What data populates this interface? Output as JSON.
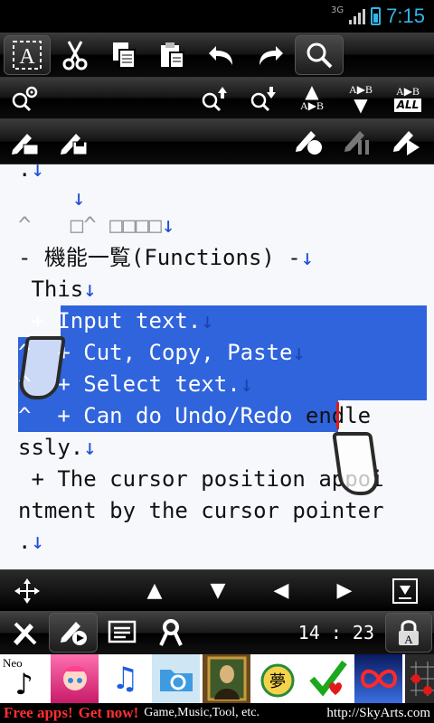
{
  "status": {
    "network": "3G",
    "time": "7:15"
  },
  "toolbar_main": {
    "icons": [
      "select-text-icon",
      "cut-icon",
      "copy-icon",
      "paste-icon",
      "undo-icon",
      "redo-icon",
      "search-icon"
    ]
  },
  "toolbar_search": {
    "icons": [
      "search-settings-icon",
      "search-previous-icon",
      "search-next-icon",
      "replace-icon",
      "replace-next-icon",
      "replace-all-icon"
    ],
    "replace_label": "A▶B",
    "replace_all_label": "ALL"
  },
  "toolbar_file": {
    "icons": [
      "new-file-icon",
      "save-file-icon",
      "pen-record-icon",
      "pen-pause-icon",
      "pen-play-icon"
    ]
  },
  "editor": {
    "lines": [
      {
        "text": ".",
        "ret": "↓"
      },
      {
        "text": "   ",
        "ret": "↓"
      },
      {
        "text": "^   □^ □□□□",
        "ret": "↓"
      },
      {
        "text": "- 機能一覧(Functions) -",
        "ret": "↓"
      },
      {
        "text": " This",
        "ret": "↓"
      },
      {
        "text": " + Input text.",
        "ret": "↓"
      },
      {
        "text": "^  + Cut, Copy, Paste",
        "ret": "↓"
      },
      {
        "text": "^  + Select text.",
        "ret": "↓"
      },
      {
        "text": "^  + Can do Undo/Redo",
        "ret": "",
        "after": " endle"
      },
      {
        "text": "ssly.",
        "ret": "↓"
      },
      {
        "text": " + The cursor position appoi",
        "ret": ""
      },
      {
        "text": "ntment by the cursor pointer",
        "ret": ""
      },
      {
        "text": ".",
        "ret": "↓"
      }
    ]
  },
  "cursor_pad": {
    "icons": [
      "move-icon",
      "up-arrow-icon",
      "down-arrow-icon",
      "left-arrow-icon",
      "right-arrow-icon",
      "end-of-document-icon"
    ],
    "up": "▲",
    "down": "▼",
    "left": "◀",
    "right": "▶"
  },
  "bottom_bar": {
    "icons": [
      "tools-icon",
      "pen-mode-icon",
      "list-icon",
      "ribbon-icon",
      "lock-icon"
    ],
    "time": "14 : 23"
  },
  "ad": {
    "neo_label": "Neo",
    "free": "Free apps!",
    "get_now": "Get now!",
    "categories": "Game,Music,Tool, etc.",
    "url": "http://SkyArts.com",
    "tiles": [
      "music-note-app-icon",
      "anime-girl-app-icon",
      "blue-note-app-icon",
      "folder-app-icon",
      "mona-lisa-app-icon",
      "dream-app-icon",
      "check-heart-app-icon",
      "infinity-app-icon",
      "go-board-app-icon"
    ],
    "dream_char": "夢"
  },
  "colors": {
    "selection": "#3064dc",
    "return_mark": "#1f4fd6",
    "caret": "#e01a1a",
    "status_accent": "#33b5e5",
    "ad_red": "#ff3030"
  }
}
